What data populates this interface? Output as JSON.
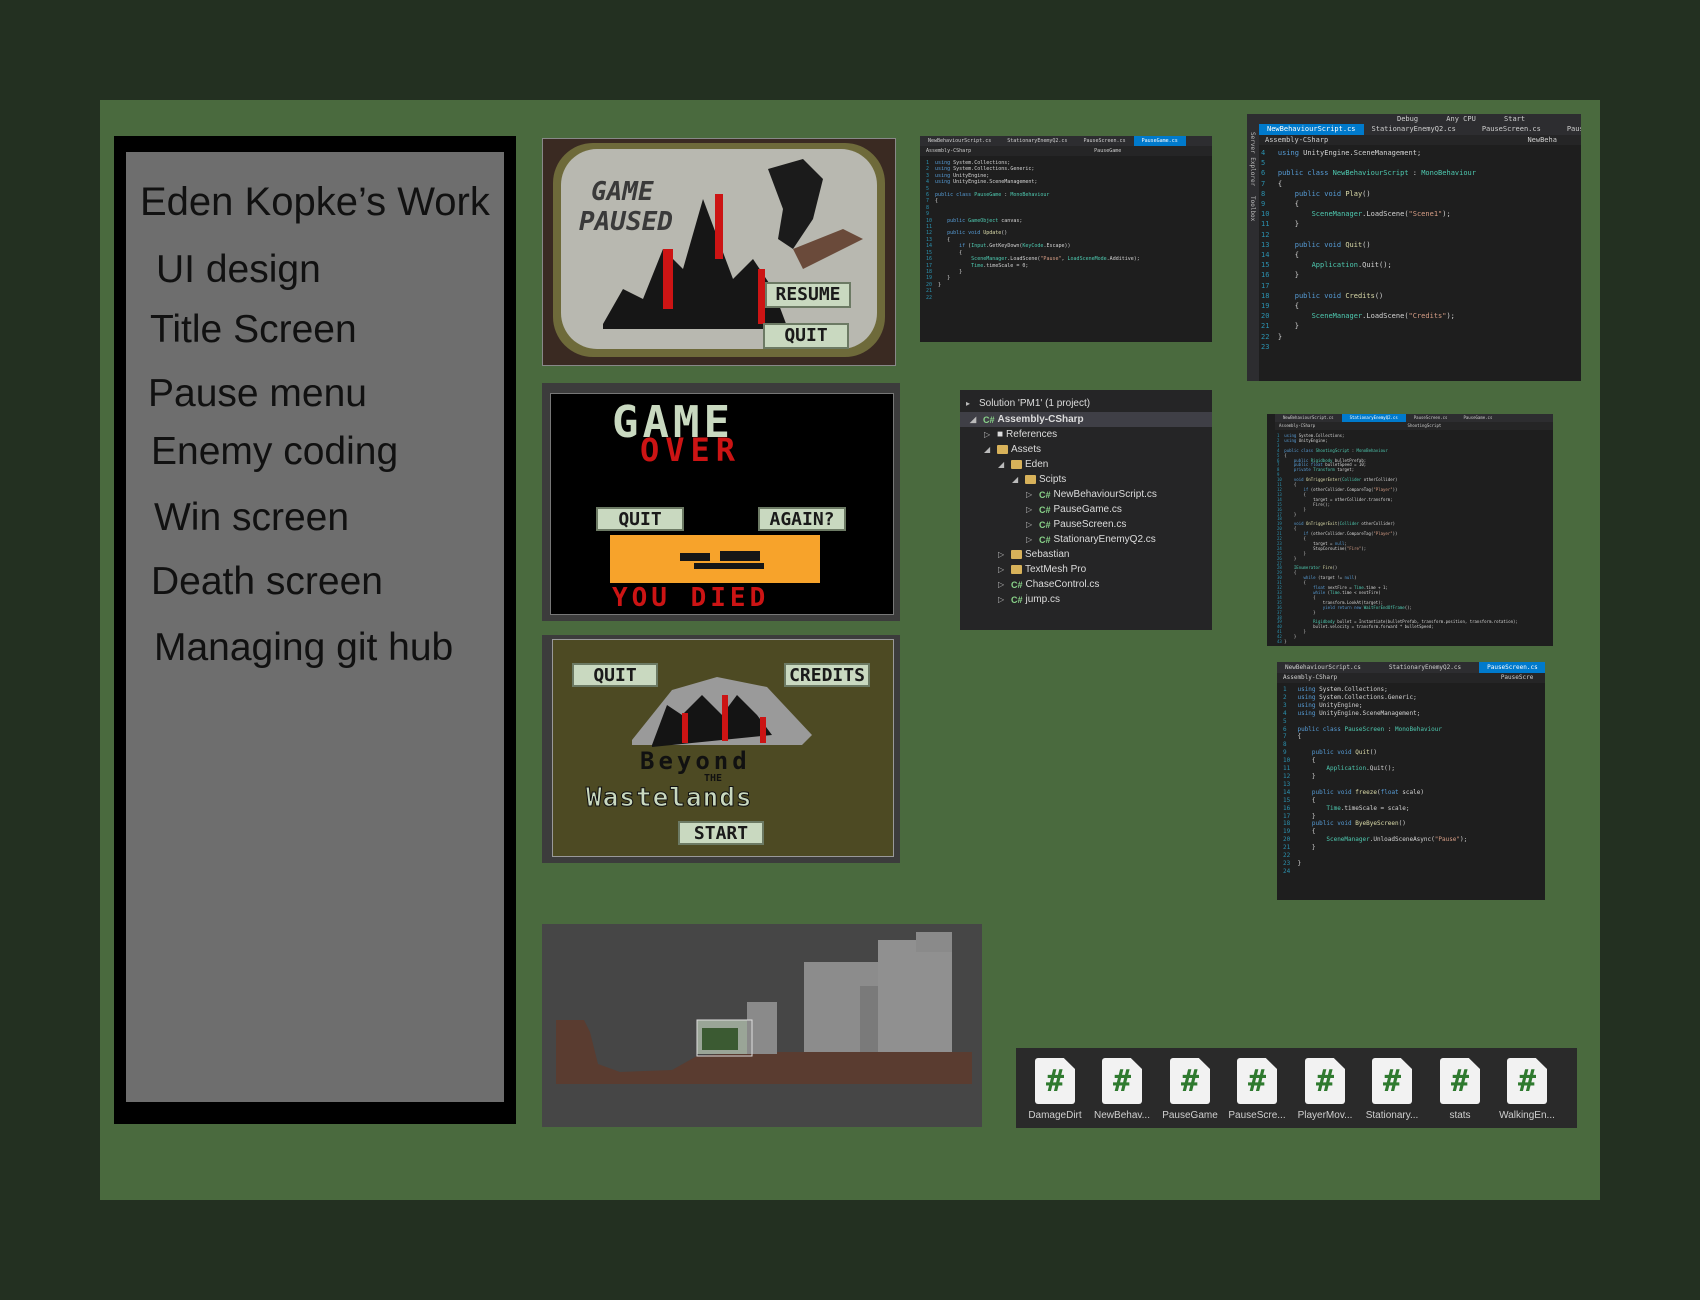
{
  "sidebar": {
    "title": "Eden Kopke’s Work",
    "items": [
      "UI design",
      "Title Screen",
      "Pause menu",
      "Enemy coding",
      "Win screen",
      "Death screen",
      "Managing git hub"
    ]
  },
  "pause_screen": {
    "title_line1": "GAME",
    "title_line2": "PAUSED",
    "resume": "RESUME",
    "quit": "QUIT"
  },
  "game_over_screen": {
    "title_line1": "GAME",
    "title_line2": "OVER",
    "quit": "QUIT",
    "again": "AGAIN?",
    "footer": "YOU DIED"
  },
  "title_screen": {
    "quit": "QUIT",
    "credits": "CREDITS",
    "logo_line1": "Beyond",
    "logo_line2": "THE",
    "logo_line3": "Wastelands",
    "start": "START"
  },
  "code_pausegame": {
    "tabs": [
      "NewBehaviourScript.cs",
      "StationaryEnemyQ2.cs",
      "PauseScreen.cs",
      "PauseGame.cs"
    ],
    "assembly": "Assembly-CSharp",
    "member": "PauseGame"
  },
  "code_newbehaviour": {
    "toolbar_config": "Debug",
    "toolbar_platform": "Any CPU",
    "toolbar_start": "Start",
    "side_labels": [
      "Server Explorer",
      "Toolbox"
    ],
    "tabs": [
      "NewBehaviourScript.cs",
      "StationaryEnemyQ2.cs",
      "PauseScreen.cs",
      "Pause"
    ],
    "assembly": "Assembly-CSharp",
    "member": "NewBeha"
  },
  "solution_explorer": {
    "rows": [
      "Solution 'PM1' (1 project)",
      "Assembly-CSharp",
      "References",
      "Assets",
      "Eden",
      "Scipts",
      "NewBehaviourScript.cs",
      "PauseGame.cs",
      "PauseScreen.cs",
      "StationaryEnemyQ2.cs",
      "Sebastian",
      "TextMesh Pro",
      "ChaseControl.cs",
      "jump.cs"
    ]
  },
  "code_stationary": {
    "tabs": [
      "NewBehaviourScript.cs",
      "StationaryEnemyQ2.cs",
      "PauseScreen.cs",
      "PauseGame.cs"
    ],
    "assembly": "Assembly-CSharp",
    "member": "ShootingScript"
  },
  "code_pausescreen": {
    "tabs": [
      "NewBehaviourScript.cs",
      "StationaryEnemyQ2.cs",
      "PauseScreen.cs"
    ],
    "assembly": "Assembly-CSharp",
    "member": "PauseScre"
  },
  "project_files": [
    "DamageDirt",
    "NewBehav...",
    "PauseGame",
    "PauseScre...",
    "PlayerMov...",
    "Stationary...",
    "stats",
    "WalkingEn..."
  ],
  "file_icon_glyph": "#",
  "colors": {
    "board": "#4a6a3e",
    "outer": "#233021",
    "sidebar": "#6e6e6e",
    "accent_red": "#cc1414",
    "button_green": "#c9d9c0"
  }
}
